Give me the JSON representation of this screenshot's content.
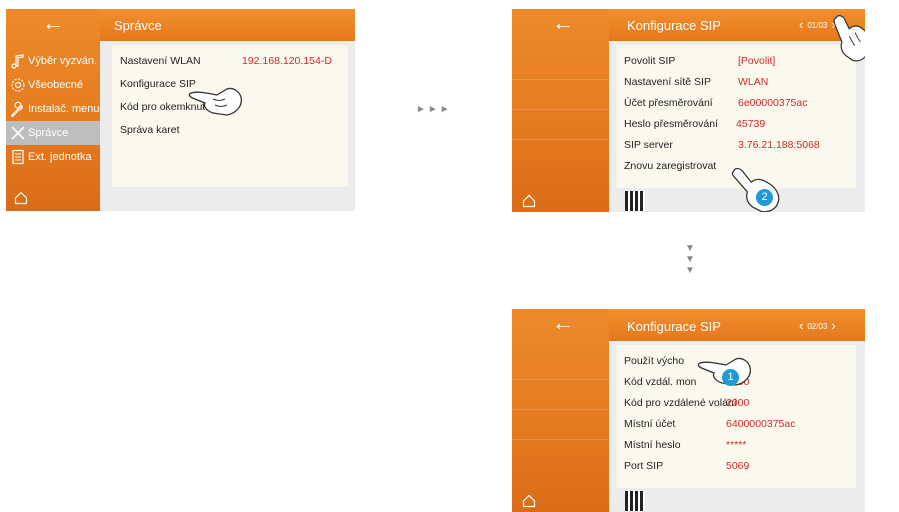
{
  "screen1": {
    "title": "Správce",
    "back_icon": "arrow-left-icon",
    "sidebar": [
      {
        "label": "Výběr vyzván.",
        "icon": "music-note-icon"
      },
      {
        "label": "Všeobecné",
        "icon": "gear-icon"
      },
      {
        "label": "Instalač. menu",
        "icon": "wrench-icon"
      },
      {
        "label": "Správce",
        "icon": "tools-icon",
        "active": true
      },
      {
        "label": "Ext. jednotka",
        "icon": "document-icon"
      }
    ],
    "rows": [
      {
        "label": "Nastavení WLAN",
        "value": "192.168.120.154-D"
      },
      {
        "label": "Konfigurace SIP",
        "value": ""
      },
      {
        "label": "Kód pro okemknutí",
        "value": ""
      },
      {
        "label": "Správa karet",
        "value": ""
      }
    ]
  },
  "flow_arrow": "►►►",
  "down_arrows": [
    "▼",
    "▼",
    "▼"
  ],
  "screen2": {
    "title": "Konfigurace SIP",
    "page": "01/03",
    "rows": [
      {
        "label": "Povolit SIP",
        "value": "[Povolit]"
      },
      {
        "label": "Nastavení sítě SIP",
        "value": "WLAN"
      },
      {
        "label": "Účet přesměrování",
        "value": "6e00000375ac"
      },
      {
        "label": "Heslo přesměrování",
        "value": "45739"
      },
      {
        "label": "SIP server",
        "value": "3.76.21.188:5068"
      },
      {
        "label": "Znovu zaregistrovat",
        "value": ""
      }
    ],
    "step_badge": "2"
  },
  "screen3": {
    "title": "Konfigurace SIP",
    "page": "02/03",
    "rows": [
      {
        "label": "Použít výcho",
        "value": ""
      },
      {
        "label": "Kód vzdál. mon",
        "value": "1000"
      },
      {
        "label": "Kód pro vzdálené volání",
        "value": "2000"
      },
      {
        "label": "Místní účet",
        "value": "6400000375ac"
      },
      {
        "label": "Místní heslo",
        "value": "*****"
      },
      {
        "label": "Port SIP",
        "value": "5069"
      }
    ],
    "step_badge": "1"
  },
  "colors": {
    "accent": "#e8801f",
    "value_red": "#d12a2a",
    "panel": "#fbf9ed",
    "badge": "#1e9ad6"
  }
}
